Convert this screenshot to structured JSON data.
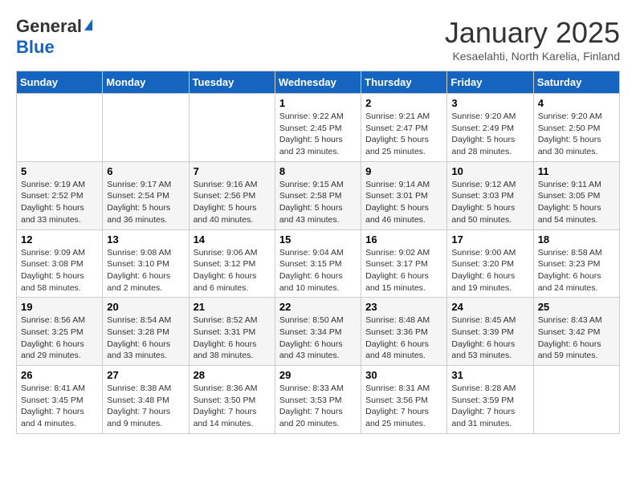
{
  "header": {
    "logo_general": "General",
    "logo_blue": "Blue",
    "month_title": "January 2025",
    "location": "Kesaelahti, North Karelia, Finland"
  },
  "days_of_week": [
    "Sunday",
    "Monday",
    "Tuesday",
    "Wednesday",
    "Thursday",
    "Friday",
    "Saturday"
  ],
  "weeks": [
    {
      "days": [
        {
          "number": "",
          "info": ""
        },
        {
          "number": "",
          "info": ""
        },
        {
          "number": "",
          "info": ""
        },
        {
          "number": "1",
          "info": "Sunrise: 9:22 AM\nSunset: 2:45 PM\nDaylight: 5 hours and 23 minutes."
        },
        {
          "number": "2",
          "info": "Sunrise: 9:21 AM\nSunset: 2:47 PM\nDaylight: 5 hours and 25 minutes."
        },
        {
          "number": "3",
          "info": "Sunrise: 9:20 AM\nSunset: 2:49 PM\nDaylight: 5 hours and 28 minutes."
        },
        {
          "number": "4",
          "info": "Sunrise: 9:20 AM\nSunset: 2:50 PM\nDaylight: 5 hours and 30 minutes."
        }
      ]
    },
    {
      "days": [
        {
          "number": "5",
          "info": "Sunrise: 9:19 AM\nSunset: 2:52 PM\nDaylight: 5 hours and 33 minutes."
        },
        {
          "number": "6",
          "info": "Sunrise: 9:17 AM\nSunset: 2:54 PM\nDaylight: 5 hours and 36 minutes."
        },
        {
          "number": "7",
          "info": "Sunrise: 9:16 AM\nSunset: 2:56 PM\nDaylight: 5 hours and 40 minutes."
        },
        {
          "number": "8",
          "info": "Sunrise: 9:15 AM\nSunset: 2:58 PM\nDaylight: 5 hours and 43 minutes."
        },
        {
          "number": "9",
          "info": "Sunrise: 9:14 AM\nSunset: 3:01 PM\nDaylight: 5 hours and 46 minutes."
        },
        {
          "number": "10",
          "info": "Sunrise: 9:12 AM\nSunset: 3:03 PM\nDaylight: 5 hours and 50 minutes."
        },
        {
          "number": "11",
          "info": "Sunrise: 9:11 AM\nSunset: 3:05 PM\nDaylight: 5 hours and 54 minutes."
        }
      ]
    },
    {
      "days": [
        {
          "number": "12",
          "info": "Sunrise: 9:09 AM\nSunset: 3:08 PM\nDaylight: 5 hours and 58 minutes."
        },
        {
          "number": "13",
          "info": "Sunrise: 9:08 AM\nSunset: 3:10 PM\nDaylight: 6 hours and 2 minutes."
        },
        {
          "number": "14",
          "info": "Sunrise: 9:06 AM\nSunset: 3:12 PM\nDaylight: 6 hours and 6 minutes."
        },
        {
          "number": "15",
          "info": "Sunrise: 9:04 AM\nSunset: 3:15 PM\nDaylight: 6 hours and 10 minutes."
        },
        {
          "number": "16",
          "info": "Sunrise: 9:02 AM\nSunset: 3:17 PM\nDaylight: 6 hours and 15 minutes."
        },
        {
          "number": "17",
          "info": "Sunrise: 9:00 AM\nSunset: 3:20 PM\nDaylight: 6 hours and 19 minutes."
        },
        {
          "number": "18",
          "info": "Sunrise: 8:58 AM\nSunset: 3:23 PM\nDaylight: 6 hours and 24 minutes."
        }
      ]
    },
    {
      "days": [
        {
          "number": "19",
          "info": "Sunrise: 8:56 AM\nSunset: 3:25 PM\nDaylight: 6 hours and 29 minutes."
        },
        {
          "number": "20",
          "info": "Sunrise: 8:54 AM\nSunset: 3:28 PM\nDaylight: 6 hours and 33 minutes."
        },
        {
          "number": "21",
          "info": "Sunrise: 8:52 AM\nSunset: 3:31 PM\nDaylight: 6 hours and 38 minutes."
        },
        {
          "number": "22",
          "info": "Sunrise: 8:50 AM\nSunset: 3:34 PM\nDaylight: 6 hours and 43 minutes."
        },
        {
          "number": "23",
          "info": "Sunrise: 8:48 AM\nSunset: 3:36 PM\nDaylight: 6 hours and 48 minutes."
        },
        {
          "number": "24",
          "info": "Sunrise: 8:45 AM\nSunset: 3:39 PM\nDaylight: 6 hours and 53 minutes."
        },
        {
          "number": "25",
          "info": "Sunrise: 8:43 AM\nSunset: 3:42 PM\nDaylight: 6 hours and 59 minutes."
        }
      ]
    },
    {
      "days": [
        {
          "number": "26",
          "info": "Sunrise: 8:41 AM\nSunset: 3:45 PM\nDaylight: 7 hours and 4 minutes."
        },
        {
          "number": "27",
          "info": "Sunrise: 8:38 AM\nSunset: 3:48 PM\nDaylight: 7 hours and 9 minutes."
        },
        {
          "number": "28",
          "info": "Sunrise: 8:36 AM\nSunset: 3:50 PM\nDaylight: 7 hours and 14 minutes."
        },
        {
          "number": "29",
          "info": "Sunrise: 8:33 AM\nSunset: 3:53 PM\nDaylight: 7 hours and 20 minutes."
        },
        {
          "number": "30",
          "info": "Sunrise: 8:31 AM\nSunset: 3:56 PM\nDaylight: 7 hours and 25 minutes."
        },
        {
          "number": "31",
          "info": "Sunrise: 8:28 AM\nSunset: 3:59 PM\nDaylight: 7 hours and 31 minutes."
        },
        {
          "number": "",
          "info": ""
        }
      ]
    }
  ]
}
